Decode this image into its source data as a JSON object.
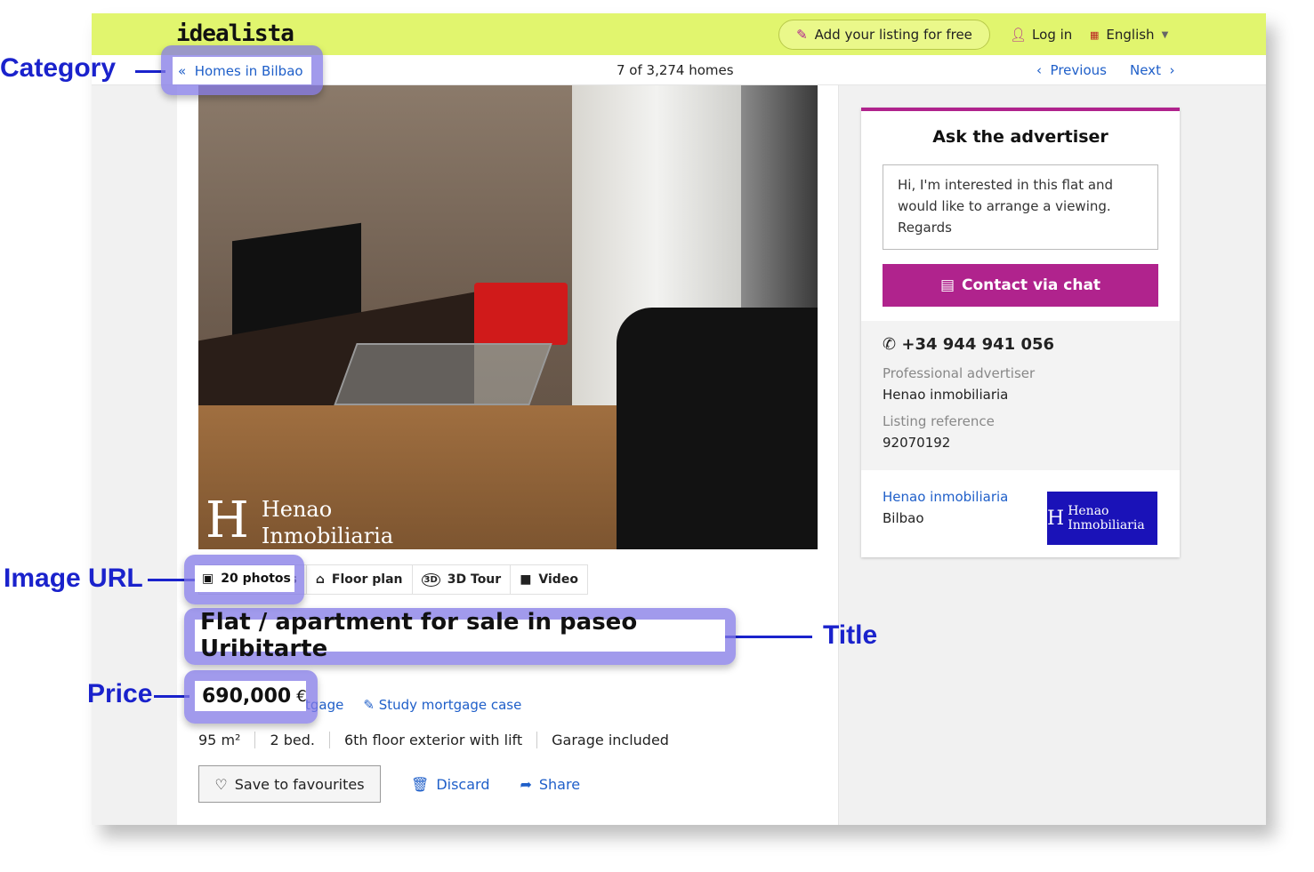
{
  "header": {
    "logo": "idealista",
    "add_listing": "Add your listing for free",
    "login": "Log in",
    "language": "English"
  },
  "subnav": {
    "back": "Homes in Bilbao",
    "count": "7 of 3,274 homes",
    "previous": "Previous",
    "next": "Next"
  },
  "photo": {
    "watermark_line1": "Henao",
    "watermark_line2": "Inmobiliaria"
  },
  "media_tabs": [
    {
      "label": "20 photos",
      "icon": "image-icon"
    },
    {
      "label": "Floor plan",
      "icon": "floor-plan-icon"
    },
    {
      "label": "3D Tour",
      "icon": "3d-icon"
    },
    {
      "label": "Video",
      "icon": "video-icon"
    }
  ],
  "listing": {
    "title": "Flat / apartment for sale in paseo Uribitarte",
    "price": "690,000",
    "currency": "€",
    "mortgage_partial": "tgage",
    "study_mortgage": "Study mortgage case",
    "features": [
      "95  m²",
      "2  bed.",
      "6th floor  exterior with lift",
      "Garage included"
    ]
  },
  "actions": {
    "save": "Save to favourites",
    "discard": "Discard",
    "share": "Share"
  },
  "contact": {
    "title": "Ask the advertiser",
    "message": "Hi, I'm interested in this flat and would like to arrange a viewing. Regards",
    "chat": "Contact via chat",
    "phone": "+34 944 941 056",
    "advertiser_label": "Professional advertiser",
    "advertiser": "Henao inmobiliaria",
    "ref_label": "Listing reference",
    "ref": "92070192",
    "agency_link": "Henao inmobiliaria",
    "agency_city": "Bilbao",
    "agency_logo": "Henao Inmobiliaria"
  },
  "annotations": {
    "category": "Category",
    "image_url": "Image URL",
    "title": "Title",
    "price": "Price"
  },
  "colors": {
    "header": "#e1f56e",
    "accent": "#b0238d",
    "link": "#1f5fc9",
    "annotation": "#1a22cc"
  }
}
